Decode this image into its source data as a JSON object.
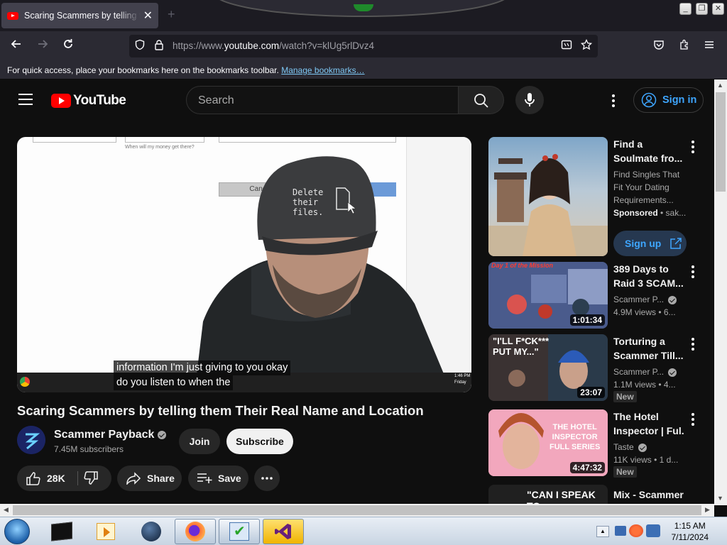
{
  "browser": {
    "tab_title": "Scaring Scammers by telling them Their Real Name and Location",
    "tab_close": "✕",
    "new_tab": "+",
    "url_prefix": "https://www.",
    "url_host": "youtube.com",
    "url_path": "/watch?v=klUg5rlDvz4",
    "bookmarks_text": "For quick access, place your bookmarks here on the bookmarks toolbar.",
    "bookmarks_link": "Manage bookmarks…"
  },
  "youtube": {
    "logo_text": "YouTube",
    "search_placeholder": "Search",
    "sign_in": "Sign in"
  },
  "video": {
    "title": "Scaring Scammers by telling them Their Real Name and Location",
    "caption_line1": "information I'm just giving to you okay",
    "caption_line2": "do you listen to when the",
    "hat_text": "Delete\ntheir\nfiles.",
    "screen_cancel": "Cancel",
    "screen_question": "When will my money get there?",
    "screen_time": "1:46 PM",
    "screen_day": "Friday"
  },
  "channel": {
    "name": "Scammer Payback",
    "subscribers": "7.45M subscribers",
    "join": "Join",
    "subscribe": "Subscribe"
  },
  "actions": {
    "likes": "28K",
    "share": "Share",
    "save": "Save"
  },
  "sidebar": {
    "ad": {
      "title_l1": "Find a",
      "title_l2": "Soulmate fro...",
      "desc_l1": "Find Singles That",
      "desc_l2": "Fit Your Dating",
      "desc_l3": "Requirements...",
      "sponsored": "Sponsored",
      "advertiser": "• sak...",
      "cta": "Sign up"
    },
    "items": [
      {
        "title_l1": "389 Days to",
        "title_l2": "Raid 3 SCAM...",
        "channel": "Scammer P...",
        "meta": "4.9M views  • 6...",
        "duration": "1:01:34",
        "thumb_text": "Day 1 of the Mission",
        "badge": ""
      },
      {
        "title_l1": "Torturing a",
        "title_l2": "Scammer Till...",
        "channel": "Scammer P...",
        "meta": "1.1M views  • 4...",
        "duration": "23:07",
        "thumb_text": "\"I'LL F*CK***\nPUT MY...\"",
        "badge": "New"
      },
      {
        "title_l1": "The Hotel",
        "title_l2": "Inspector | Ful...",
        "channel": "Taste",
        "meta": "11K views  • 1 d...",
        "duration": "4:47:32",
        "thumb_text": "THE HOTEL\nINSPECTOR\nFULL SERIES",
        "badge": "New"
      },
      {
        "title_l1": "Mix - Scammer",
        "thumb_text": "\"CAN I SPEAK\nTO"
      }
    ]
  },
  "taskbar": {
    "time": "1:15 AM",
    "date": "7/11/2024"
  },
  "colors": {
    "youtube_red": "#ff0000",
    "link_blue": "#3ea6ff",
    "page_bg": "#0f0f0f"
  }
}
